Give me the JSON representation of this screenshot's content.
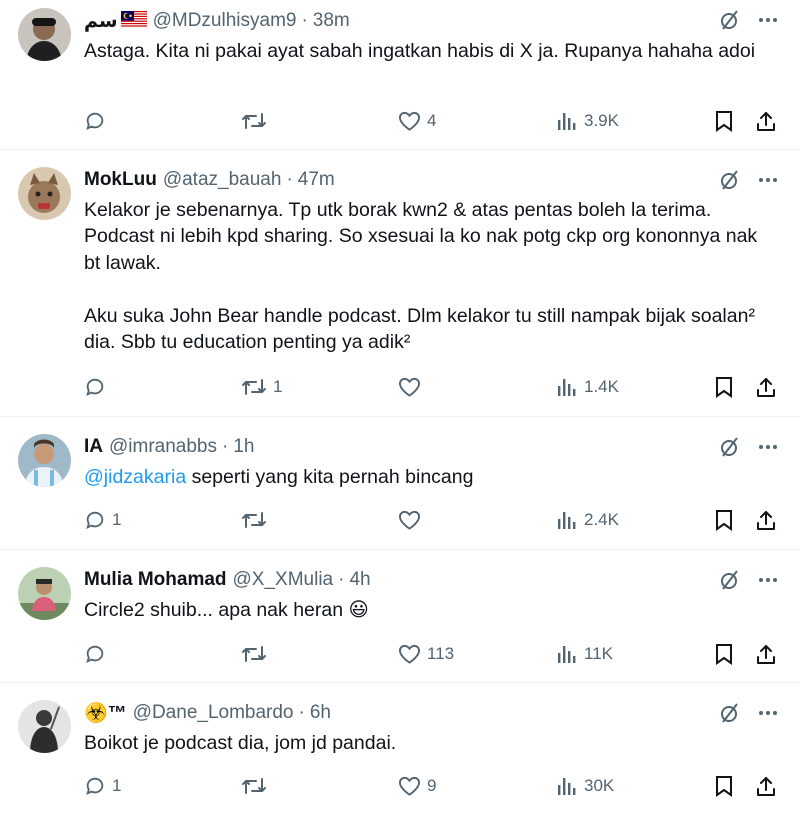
{
  "colors": {
    "text": "#0f1419",
    "muted": "#536471",
    "link": "#1d9bf0",
    "divider": "#eff3f4"
  },
  "icons": {
    "grok": "slashed-circle-icon",
    "more": "more-options-icon",
    "reply": "reply-icon",
    "repost": "repost-icon",
    "like": "like-icon",
    "views": "views-icon",
    "bookmark": "bookmark-icon",
    "share": "share-icon"
  },
  "tweets": [
    {
      "name": "سم",
      "handle": "@MDzulhisyam9",
      "separator": "·",
      "time": "38m",
      "text_before": "",
      "mention": "",
      "text": "Astaga. Kita ni pakai ayat sabah ingatkan habis di X ja. Rupanya hahaha adoi",
      "replies": "",
      "reposts": "",
      "likes": "4",
      "views": "3.9K"
    },
    {
      "name": "MokLuu",
      "handle": "@ataz_bauah",
      "separator": "·",
      "time": "47m",
      "text_before": "",
      "mention": "",
      "text": "Kelakor je sebenarnya. Tp utk borak kwn2 & atas pentas boleh la terima. Podcast ni lebih kpd sharing. So xsesuai la ko nak potg ckp org kononnya nak bt lawak.\n\nAku suka John Bear handle podcast. Dlm kelakor tu still nampak bijak soalan² dia. Sbb tu education penting ya adik²",
      "replies": "",
      "reposts": "1",
      "likes": "",
      "views": "1.4K"
    },
    {
      "name": "IA",
      "handle": "@imranabbs",
      "separator": "·",
      "time": "1h",
      "text_before": "",
      "mention": "@jidzakaria",
      "text": " seperti yang kita pernah bincang",
      "replies": "1",
      "reposts": "",
      "likes": "",
      "views": "2.4K"
    },
    {
      "name": "Mulia Mohamad",
      "handle": "@X_XMulia",
      "separator": "·",
      "time": "4h",
      "text_before": "",
      "mention": "",
      "text": "Circle2 shuib... apa nak heran 😃",
      "replies": "",
      "reposts": "",
      "likes": "113",
      "views": "11K"
    },
    {
      "name": "☣️™",
      "handle": "@Dane_Lombardo",
      "separator": "·",
      "time": "6h",
      "text_before": "",
      "mention": "",
      "text": "Boikot je podcast dia, jom jd pandai.",
      "replies": "1",
      "reposts": "",
      "likes": "9",
      "views": "30K"
    }
  ]
}
